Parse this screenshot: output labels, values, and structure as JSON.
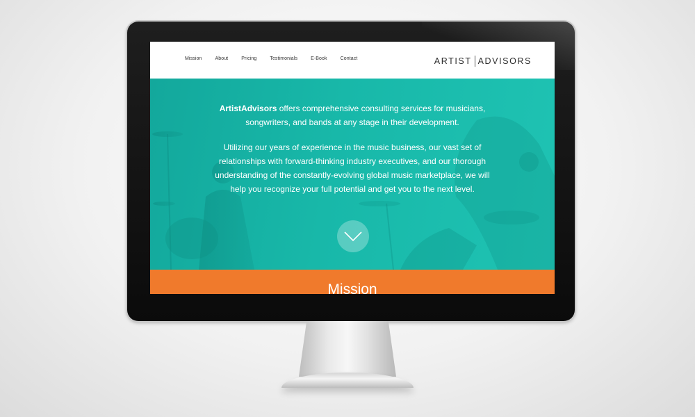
{
  "nav": {
    "links": [
      "Mission",
      "About",
      "Pricing",
      "Testimonials",
      "E-Book",
      "Contact"
    ]
  },
  "logo": {
    "left": "ARTIST",
    "right": "ADVISORS"
  },
  "hero": {
    "brand": "ArtistAdvisors",
    "line1_rest": " offers comprehensive consulting services for musicians,",
    "line2": "songwriters, and bands at any stage in their development.",
    "para2": [
      "Utilizing our years of experience in the music business, our vast set of",
      "relationships with forward-thinking industry executives, and our thorough",
      "understanding of the constantly-evolving global music marketplace, we will",
      "help you recognize your full potential and get you to the next level."
    ],
    "scroll_icon": "chevron-down-icon"
  },
  "mission": {
    "title": "Mission"
  },
  "colors": {
    "hero": "#18b8a9",
    "mission": "#f07a2c",
    "bezel": "#111111"
  }
}
